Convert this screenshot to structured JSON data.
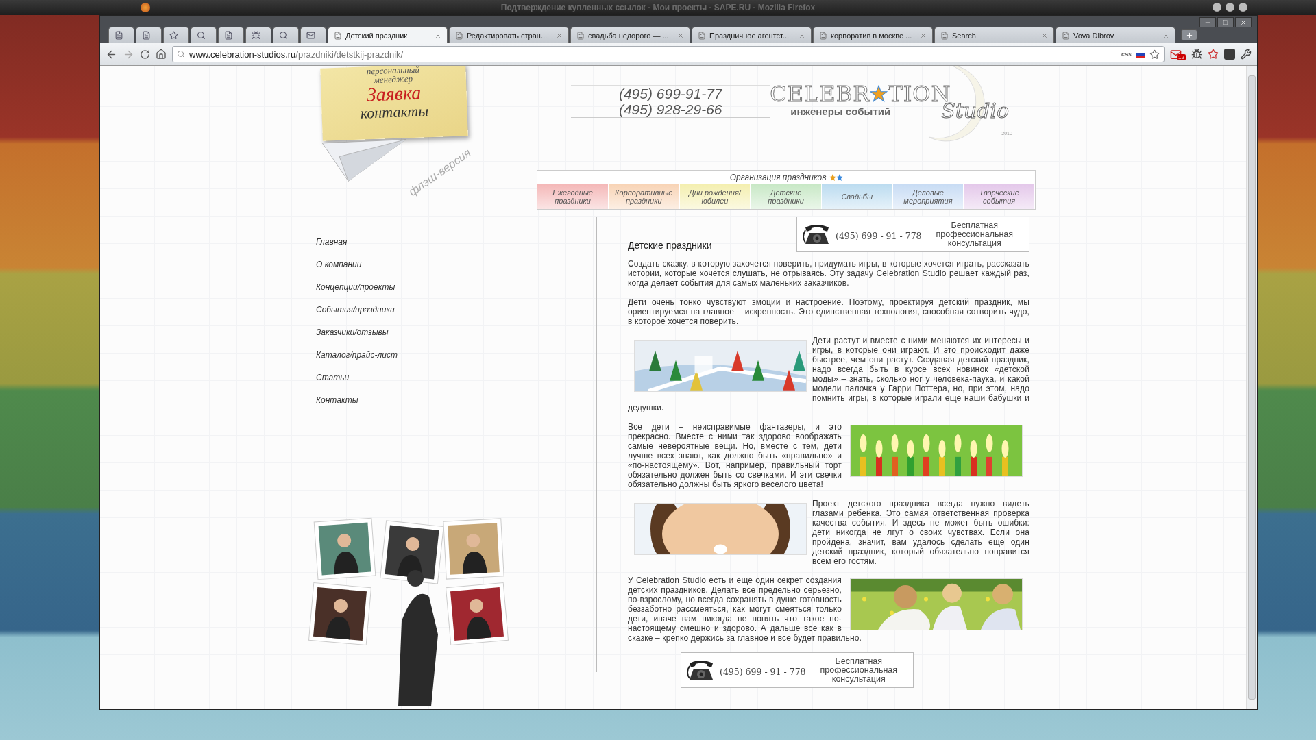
{
  "desktop": {
    "title": "Подтверждение купленных ссылок - Мои проекты - SAPE.RU - Mozilla Firefox"
  },
  "browser": {
    "tabs": [
      {
        "kind": "icon",
        "selected": false
      },
      {
        "kind": "icon",
        "selected": false
      },
      {
        "kind": "icon",
        "selected": false
      },
      {
        "kind": "icon",
        "selected": false
      },
      {
        "kind": "icon",
        "selected": false
      },
      {
        "kind": "icon",
        "selected": false
      },
      {
        "kind": "icon",
        "selected": false
      },
      {
        "kind": "icon",
        "selected": false
      },
      {
        "kind": "page",
        "label": "Детский праздник",
        "selected": true
      },
      {
        "kind": "page",
        "label": "Редактировать стран...",
        "selected": false
      },
      {
        "kind": "page",
        "label": "свадьба недорого — ...",
        "selected": false
      },
      {
        "kind": "page",
        "label": "Праздничное агентст...",
        "selected": false
      },
      {
        "kind": "page",
        "label": "корпоратив в москве ...",
        "selected": false
      },
      {
        "kind": "page",
        "label": "Search",
        "selected": false
      },
      {
        "kind": "page",
        "label": "Vova Dibrov",
        "selected": false
      }
    ],
    "url": {
      "host": "www.celebration-studios.ru",
      "path": "/prazdniki/detstkij-prazdnik/"
    },
    "css_label": "css",
    "mail_count": "12"
  },
  "page": {
    "note": {
      "top": "персональный менеджер",
      "request": "Заявка",
      "contacts": "контакты"
    },
    "flash_link": "флэш-версия",
    "phones": [
      "(495) 699-91-77",
      "(495) 928-29-66"
    ],
    "logo": {
      "left": "CELEBR",
      "right": "TION",
      "tagline": "инженеры событий",
      "script": "Studio",
      "year": "2010"
    },
    "categories": {
      "title": "Организация праздников",
      "items": [
        {
          "label": "Ежегодные праздники",
          "color": "#f4b8b8"
        },
        {
          "label": "Корпоративные праздники",
          "color": "#f8d4b6"
        },
        {
          "label": "Дни рождения/ юбилеи",
          "color": "#f4efb0"
        },
        {
          "label": "Детские праздники",
          "color": "#c8e8c6"
        },
        {
          "label": "Свадьбы",
          "color": "#bcdcf0"
        },
        {
          "label": "Деловые мероприятия",
          "color": "#c8dcf4"
        },
        {
          "label": "Творческие события",
          "color": "#e4c8ea"
        }
      ]
    },
    "consultation_top": {
      "phone": "(495) 699 - 91 - 778",
      "lines": [
        "Бесплатная",
        "профессиональная",
        "консультация"
      ]
    },
    "menu": [
      "Главная",
      "О компании",
      "Концепции/проекты",
      "События/праздники",
      "Заказчики/отзывы",
      "Каталог/прайс-лист",
      "Статьи",
      "Контакты"
    ],
    "heading": "Детские праздники",
    "paragraphs": [
      {
        "kind": "text",
        "text": "Создать сказку, в которую захочется поверить, придумать игры, в которые хочется играть, рассказать истории, которые хочется слушать, не отрываясь. Эту задачу Celebration Studio решает каждый раз, когда делает события для самых маленьких заказчиков."
      },
      {
        "kind": "text",
        "text": "Дети очень тонко чувствуют эмоции и настроение. Поэтому, проектируя детский праздник, мы ориентируемся на главное – искренность. Это единственная технология, способная сотворить чудо, в которое хочется поверить."
      },
      {
        "kind": "picture_left",
        "text": "Дети растут и вместе с ними меняются их интересы и игры, в которые они играют. И это происходит даже быстрее, чем они растут. Создавая детский праздник, надо всегда быть в курсе всех новинок «детской моды» – знать, сколько ног у человека-паука, и какой модели палочка у Гарри Поттера, но, при этом, надо помнить игры, в которые играли еще наши бабушки и дедушки."
      },
      {
        "kind": "picture_right",
        "text": "Все дети – неисправимые фантазеры, и это прекрасно.  Вместе с ними так здорово воображать самые невероятные вещи. Но, вместе с тем, дети лучше всех знают, как должно быть «правильно» и «по-настоящему». Вот, например, правильный торт обязательно должен быть со свечками. И эти свечки обязательно должны быть яркого веселого цвета!"
      },
      {
        "kind": "picture_left",
        "text": "Проект детского праздника всегда нужно видеть глазами ребенка. Это самая ответственная проверка качества события. И здесь не может быть ошибки: дети никогда не лгут о своих чувствах. Если она пройдена, значит, вам удалось сделать еще один детский праздник, который обязательно понравится всем его гостям."
      },
      {
        "kind": "picture_right",
        "text": "У Celebration Studio есть и еще один секрет создания детских праздников. Делать все предельно серьезно, по-взрослому, но всегда сохранять в душе готовность беззаботно рассмеяться, как могут смеяться только дети, иначе вам никогда не понять что такое по-настоящему смешно и здорово. А дальше все как в сказке – крепко держись за главное и все будет правильно."
      }
    ],
    "consultation_bottom": {
      "phone": "(495) 699 - 91 - 778",
      "lines": [
        "Бесплатная",
        "профессиональная",
        "консультация"
      ]
    }
  }
}
